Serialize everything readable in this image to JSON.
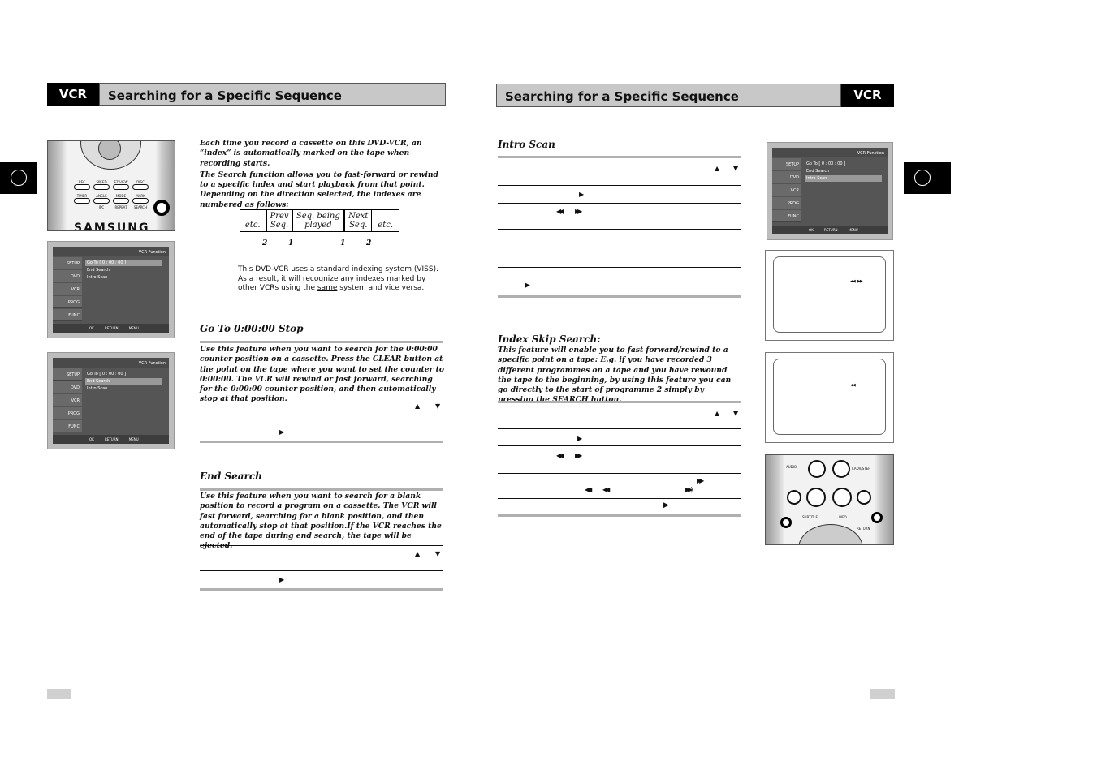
{
  "left": {
    "header": {
      "badge": "VCR",
      "title": "Searching for a Specific Sequence"
    },
    "intro": [
      "Each time you record a cassette on this DVD-VCR, an “index” is automatically marked on the tape when recording starts.",
      "The Search function allows you to fast-forward or rewind to a specific index and start playback from that point. Depending on the direction selected, the indexes are numbered as follows:"
    ],
    "seq_table": {
      "cells": [
        "etc.",
        "Prev Seq.",
        "Seq. being played",
        "Next Seq.",
        "etc."
      ],
      "numbers": [
        "2",
        "1",
        "1",
        "2"
      ]
    },
    "note": {
      "before": "This DVD-VCR uses a standard indexing system (VISS). As a result, it will recognize any indexes marked by other VCRs using the ",
      "underlined": "same",
      "after": " system and vice versa."
    },
    "goto": {
      "title": "Go To 0:00:00 Stop",
      "text": "Use this feature when you want to search for the 0:00:00 counter position on a cassette. Press the CLEAR button at the point on the tape where you want to set the counter to 0:00:00. The VCR will rewind or fast forward, searching for the 0:00:00 counter position, and then automatically stop at that position."
    },
    "end": {
      "title": "End Search",
      "text": "Use this feature when you want to search for a blank position to record a program on a cassette. The VCR will fast forward, searching for a blank position, and then automatically stop at that position.If the VCR reaches the end of the tape during end search, the tape will be ejected."
    },
    "remote": {
      "buttons": [
        "REC",
        "SPEED",
        "EZ VIEW",
        "DISC MENU",
        "TIMER",
        "ANGLE",
        "MODE",
        "MARK"
      ],
      "sublabels": [
        "IPC",
        "REPEAT",
        "SEARCH"
      ],
      "brand": "SAMSUNG"
    }
  },
  "right": {
    "header": {
      "badge": "VCR",
      "title": "Searching for a Specific Sequence"
    },
    "intro_scan": {
      "title": "Intro Scan"
    },
    "index_skip": {
      "title": "Index Skip Search:",
      "text": "This feature will enable you to fast forward/rewind to a specific point on a tape:  E.g. if you have recorded 3 different programmes on a tape and you have rewound the tape to the beginning, by using this feature you can go directly to the start of programme 2 simply by pressing the SEARCH button."
    },
    "remote": {
      "labels": [
        "AUDIO",
        "F.ADV/STEP",
        "SUBTITLE",
        "INFO",
        "RETURN"
      ]
    }
  },
  "menu": {
    "title": "VCR Function",
    "sides": [
      "SETUP",
      "DVD",
      "VCR",
      "PROG",
      "FUNC"
    ],
    "items": [
      "Go To [ 0 : 00 : 00 ]",
      "End Search",
      "Intro Scan"
    ],
    "bottom": "OK RETURN MENU"
  },
  "symbols": {
    "up": "▲",
    "down": "▼",
    "play": "▶",
    "rew": "◀◀",
    "ff": "▶▶",
    "ffp": "▶▶)"
  }
}
